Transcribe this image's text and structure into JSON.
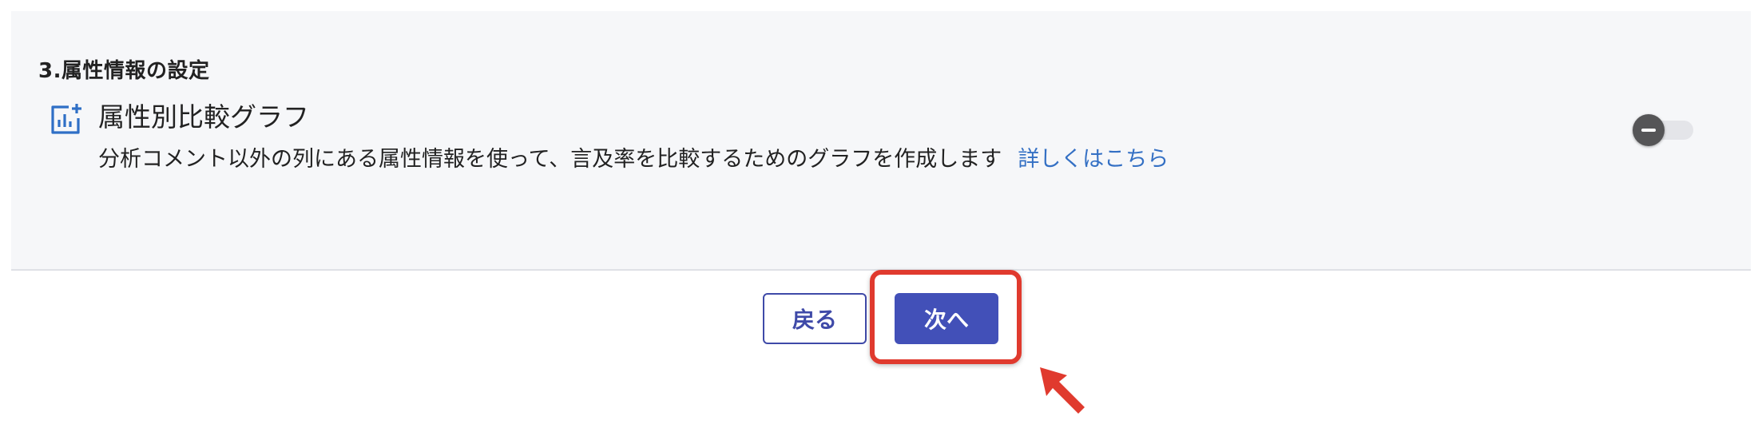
{
  "section": {
    "title": "3.属性情報の設定"
  },
  "feature": {
    "title": "属性別比較グラフ",
    "description": "分析コメント以外の列にある属性情報を使って、言及率を比較するためのグラフを作成します",
    "link_label": "詳しくはこちら",
    "icon": "chart-add-icon",
    "toggle_state": "off"
  },
  "buttons": {
    "back_label": "戻る",
    "next_label": "次へ"
  },
  "colors": {
    "panel_bg": "#f6f7f9",
    "primary": "#4250b8",
    "link": "#3470c4",
    "highlight": "#e03a2e"
  }
}
